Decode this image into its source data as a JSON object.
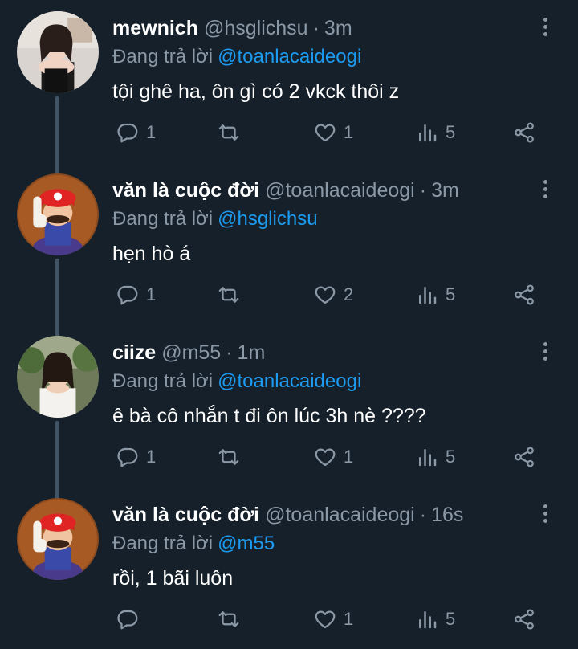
{
  "reply_prefix": "Đang trả lời",
  "tweets": [
    {
      "name": "mewnich",
      "handle": "@hsglichsu",
      "separator": "·",
      "time": "3m",
      "reply_to": "@toanlacaideogi",
      "text": "tội ghê ha, ôn gì có 2 vkck thôi z",
      "replies": "1",
      "retweets": "",
      "likes": "1",
      "views": "5"
    },
    {
      "name": "văn là cuộc đời",
      "handle": "@toanlacaideogi",
      "separator": "·",
      "time": "3m",
      "reply_to": "@hsglichsu",
      "text": "hẹn hò á",
      "replies": "1",
      "retweets": "",
      "likes": "2",
      "views": "5"
    },
    {
      "name": "ciize",
      "handle": "@m55",
      "separator": "·",
      "time": "1m",
      "reply_to": "@toanlacaideogi",
      "text": "ê bà cô nhắn t đi ôn lúc 3h nè ????",
      "replies": "1",
      "retweets": "",
      "likes": "1",
      "views": "5"
    },
    {
      "name": "văn là cuộc đời",
      "handle": "@toanlacaideogi",
      "separator": "·",
      "time": "16s",
      "reply_to": "@m55",
      "text": "rồi, 1 bãi luôn",
      "replies": "",
      "retweets": "",
      "likes": "1",
      "views": "5"
    }
  ],
  "colors": {
    "background": "#15202b",
    "text": "#ffffff",
    "muted": "#8b98a5",
    "link": "#1d9bf0",
    "thread_line": "#425364"
  },
  "icons": [
    "reply-icon",
    "retweet-icon",
    "like-icon",
    "views-icon",
    "share-icon",
    "more-options-icon"
  ]
}
